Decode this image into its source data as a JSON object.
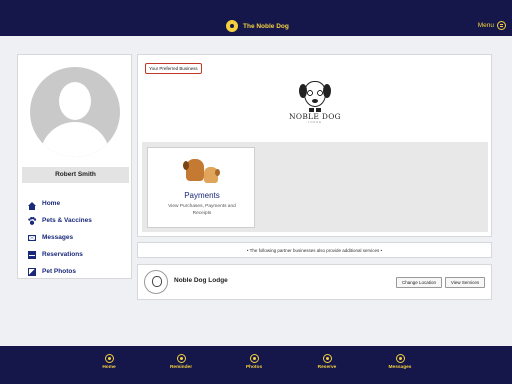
{
  "header": {
    "brand_name": "The Noble Dog",
    "menu_label": "Menu",
    "accent_color": "#f4d03f",
    "bar_color": "#15174a"
  },
  "profile": {
    "name": "Robert Smith",
    "nav": [
      {
        "label": "Home",
        "icon": "home-icon"
      },
      {
        "label": "Pets & Vaccines",
        "icon": "paw-icon"
      },
      {
        "label": "Messages",
        "icon": "mail-icon"
      },
      {
        "label": "Reservations",
        "icon": "calendar-icon"
      },
      {
        "label": "Pet Photos",
        "icon": "photo-icon"
      }
    ]
  },
  "business": {
    "preferred_badge": "Your Preferred Business",
    "logo_text": "NOBLE DOG",
    "logo_subtext": "LODGE",
    "services": [
      {
        "title": "Payments",
        "description": "View Purchases, Payments and Receipts"
      }
    ]
  },
  "partner_note": "•  The following partner businesses also provide additional services  •",
  "partners": [
    {
      "name": "Noble Dog Lodge",
      "change_label": "Change Location",
      "view_label": "View Services"
    }
  ],
  "bottom_nav": [
    {
      "label": "Home",
      "icon": "home-icon"
    },
    {
      "label": "Reminder",
      "icon": "reminder-icon"
    },
    {
      "label": "Photos",
      "icon": "photos-icon"
    },
    {
      "label": "Reserve",
      "icon": "plus-icon"
    },
    {
      "label": "Messages",
      "icon": "messages-icon"
    }
  ]
}
